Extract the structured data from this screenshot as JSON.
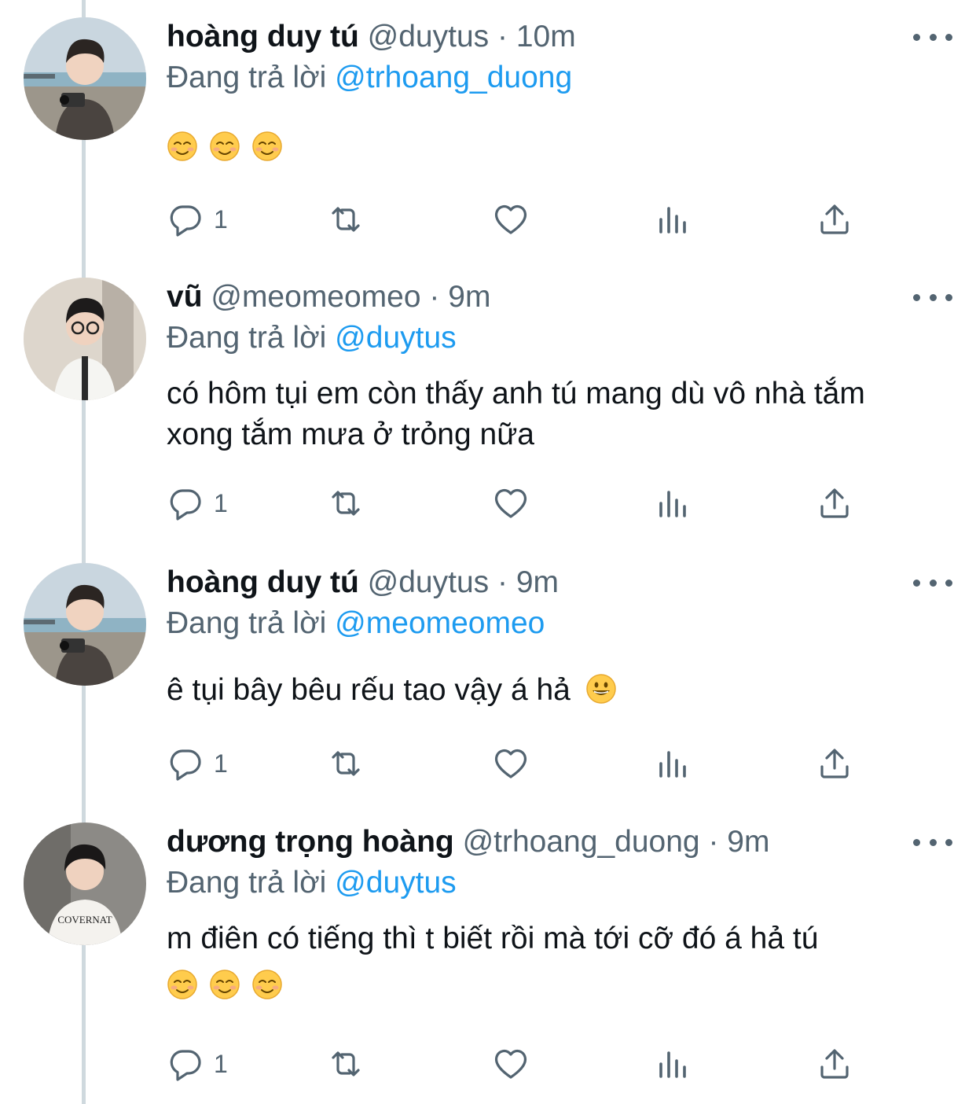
{
  "tweets": [
    {
      "name": "hoàng duy tú",
      "handle": "@duytus",
      "time": "10m",
      "replying_prefix": "Đang trả lời",
      "replying_to": "@trhoang_duong",
      "text": "",
      "emojis": [
        "☺️",
        "☺️",
        "☺️"
      ],
      "reply_count": "1",
      "avatar": "beach-avatar"
    },
    {
      "name": "vũ",
      "handle": "@meomeomeo",
      "time": "9m",
      "replying_prefix": "Đang trả lời",
      "replying_to": "@duytus",
      "text": "có hôm tụi em còn thấy anh tú mang dù vô nhà tắm xong tắm mưa ở trỏng nữa",
      "emojis": [],
      "reply_count": "1",
      "avatar": "glasses-avatar"
    },
    {
      "name": "hoàng duy tú",
      "handle": "@duytus",
      "time": "9m",
      "replying_prefix": "Đang trả lời",
      "replying_to": "@meomeomeo",
      "text": "ê tụi bây bêu rếu tao vậy á hả",
      "trailing_emoji": "😀",
      "emojis": [],
      "reply_count": "1",
      "avatar": "beach-avatar"
    },
    {
      "name": "dương trọng hoàng",
      "handle": "@trhoang_duong",
      "time": "9m",
      "replying_prefix": "Đang trả lời",
      "replying_to": "@duytus",
      "text": "m điên có tiếng thì t biết rồi mà tới cỡ đó á hả tú",
      "emojis": [
        "☺️",
        "☺️",
        "☺️"
      ],
      "reply_count": "1",
      "avatar": "covernat-avatar",
      "shirt_text": "COVERNAT"
    }
  ],
  "separator": "·",
  "icons": [
    "reply-icon",
    "retweet-icon",
    "like-icon",
    "views-icon",
    "share-icon",
    "more-icon"
  ],
  "colors": {
    "accent": "#1d9bf0",
    "secondary": "#536471",
    "thread_line": "#cfd9de"
  }
}
